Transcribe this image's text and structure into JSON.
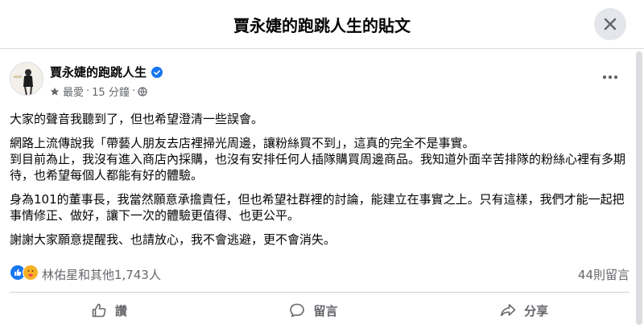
{
  "header": {
    "title": "賈永婕的跑跳人生的貼文"
  },
  "post": {
    "author": "賈永婕的跑跳人生",
    "audience": "最愛",
    "separator": "·",
    "time": "15 分鐘",
    "paragraphs": [
      "大家的聲音我聽到了，但也希望澄清一些誤會。",
      "網路上流傳說我「帶藝人朋友去店裡掃光周邊，讓粉絲買不到」，這真的完全不是事實。\n到目前為止，我沒有進入商店內採購，也沒有安排任何人插隊購買周邊商品。我知道外面辛苦排隊的粉絲心裡有多期待，也希望每個人都能有好的體驗。",
      "身為101的董事長，我當然願意承擔責任，但也希望社群裡的討論，能建立在事實之上。只有這樣，我們才能一起把事情修正、做好，讓下一次的體驗更值得、也更公平。",
      "謝謝大家願意提醒我、也請放心，我不會逃避，更不會消失。"
    ],
    "reactions_text": "林佑星和其他1,743人",
    "comments_count": "44則留言"
  },
  "actions": {
    "like": "讚",
    "comment": "留言",
    "share": "分享"
  },
  "colors": {
    "accent": "#1877f2",
    "secondary_text": "#65676b",
    "header_button_bg": "#e4e6eb"
  },
  "icons": [
    "close-icon",
    "verified-badge-icon",
    "friends-icon",
    "more-icon",
    "like-reaction-icon",
    "care-reaction-icon",
    "like-icon",
    "comment-icon",
    "share-icon"
  ]
}
